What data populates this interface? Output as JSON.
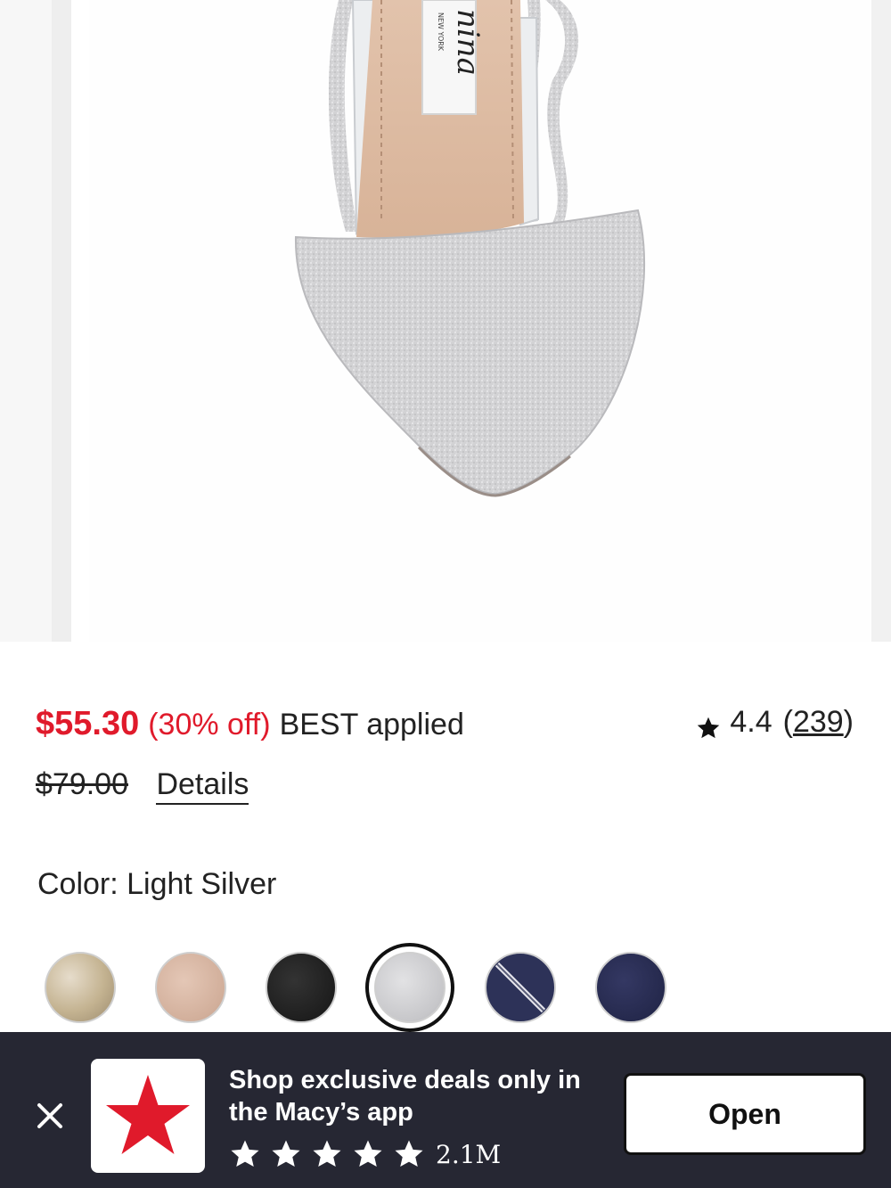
{
  "product": {
    "brand_label_text": "nina",
    "brand_label_sub": "NEW YORK",
    "sale_price": "$55.30",
    "discount": "(30% off)",
    "promo_applied": "BEST applied",
    "original_price": "$79.00",
    "details_link": "Details",
    "rating": {
      "value": "4.4",
      "review_count_prefix": "(",
      "review_count": "239",
      "review_count_suffix": ")",
      "icon": "star-icon"
    },
    "color_label": "Color: Light Silver",
    "swatches": [
      {
        "name": "Gold Glitter",
        "color": "#c9b99a",
        "selected": false
      },
      {
        "name": "Blush",
        "color": "#d9b9a6",
        "selected": false
      },
      {
        "name": "Black",
        "color": "#222222",
        "selected": false
      },
      {
        "name": "Light Silver",
        "color": "#cfcfd2",
        "selected": true
      },
      {
        "name": "Navy (unavailable)",
        "color": "#2d3258",
        "selected": false,
        "unavailable": true
      },
      {
        "name": "Navy",
        "color": "#262a4f",
        "selected": false
      }
    ]
  },
  "app_banner": {
    "close_icon": "close-icon",
    "logo_icon": "macys-star-icon",
    "message": "Shop exclusive deals only in the Macy’s app",
    "stars": 5,
    "download_count": "2.1M",
    "open_button": "Open",
    "background": "#262733",
    "accent": "#e01a2b"
  },
  "colors": {
    "sale": "#e01a2b",
    "text": "#222222"
  }
}
